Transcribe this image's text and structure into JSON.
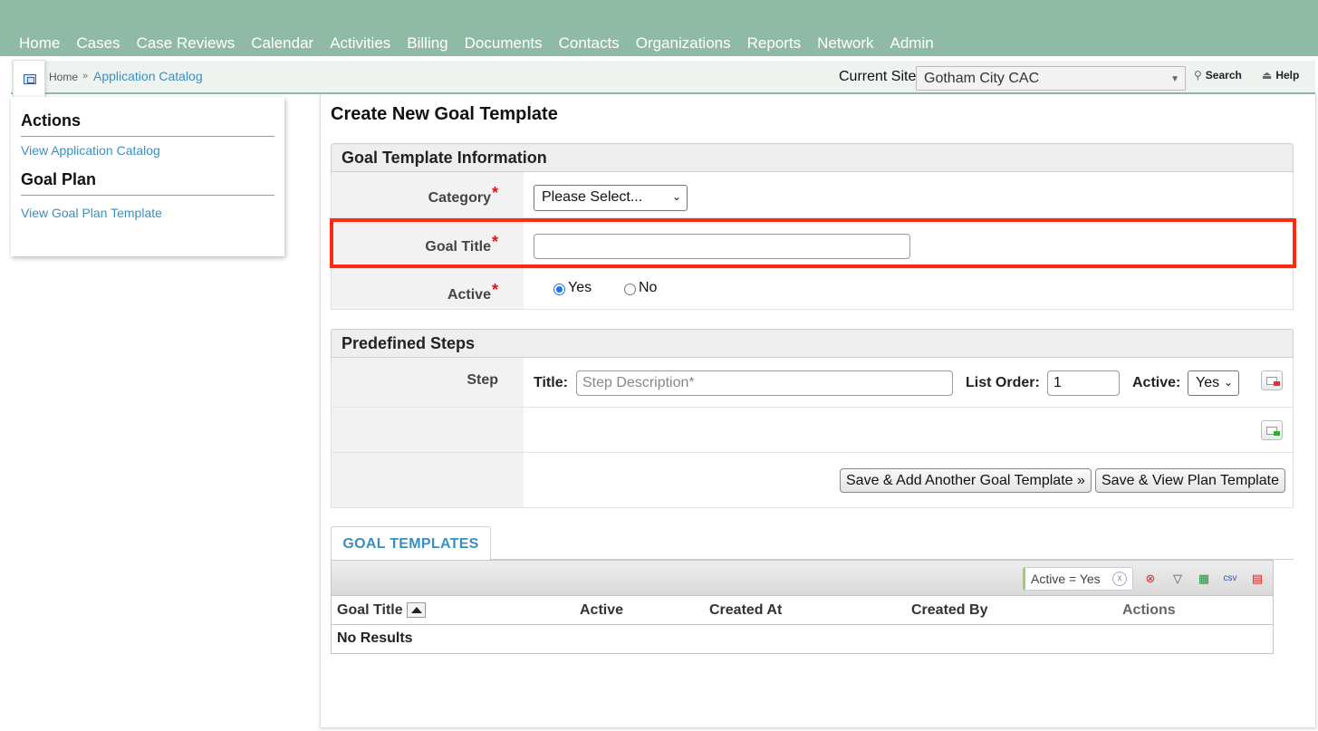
{
  "nav": {
    "items": [
      "Home",
      "Cases",
      "Case Reviews",
      "Calendar",
      "Activities",
      "Billing",
      "Documents",
      "Contacts",
      "Organizations",
      "Reports",
      "Network",
      "Admin"
    ]
  },
  "breadcrumb": {
    "home": "Home",
    "separator": "»",
    "current": "Application Catalog"
  },
  "site": {
    "label": "Current Site",
    "selected": "Gotham City CAC"
  },
  "header_links": {
    "search": "Search",
    "help": "Help"
  },
  "sidebar": {
    "actions_title": "Actions",
    "actions_link": "View Application Catalog",
    "goalplan_title": "Goal Plan",
    "goalplan_link": "View Goal Plan Template"
  },
  "page": {
    "title": "Create New Goal Template"
  },
  "goal_info": {
    "section_title": "Goal Template Information",
    "category_label": "Category",
    "category_value": "Please Select...",
    "goal_title_label": "Goal Title",
    "goal_title_value": "",
    "active_label": "Active",
    "active_yes": "Yes",
    "active_no": "No",
    "active_selected": "Yes",
    "required_mark": "*"
  },
  "steps": {
    "section_title": "Predefined Steps",
    "step_label": "Step",
    "title_label": "Title:",
    "title_placeholder": "Step Description*",
    "list_order_label": "List Order:",
    "list_order_value": "1",
    "active_label": "Active:",
    "active_value": "Yes"
  },
  "buttons": {
    "save_add_another": "Save & Add Another Goal Template »",
    "save_view": "Save & View Plan Template"
  },
  "grid": {
    "tab_label": "GOAL TEMPLATES",
    "filter_chip": "Active = Yes",
    "filter_chip_remove": "x",
    "csv_label": "csv",
    "columns": [
      "Goal Title",
      "Active",
      "Created At",
      "Created By",
      "Actions"
    ],
    "empty_text": "No Results"
  },
  "colors": {
    "nav_bg": "#8fbba6",
    "link": "#3a8fbf",
    "required": "#e0161c",
    "highlight": "#ff2a12"
  }
}
